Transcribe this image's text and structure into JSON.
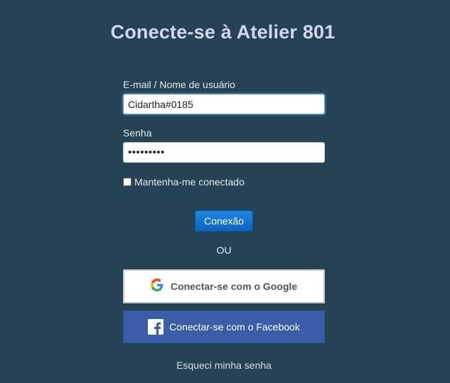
{
  "page": {
    "title": "Conecte-se à Atelier 801"
  },
  "form": {
    "email_label": "E-mail / Nome de usuário",
    "email_value": "Cidartha#0185",
    "password_label": "Senha",
    "password_value": "•••••••••",
    "remember_label": "Mantenha-me conectado",
    "remember_checked": false,
    "login_button": "Conexão"
  },
  "divider": {
    "or_text": "OU"
  },
  "social": {
    "google_label": "Conectar-se com o Google",
    "google_icon": "google-icon",
    "facebook_label": "Conectar-se com o Facebook",
    "facebook_icon": "facebook-icon"
  },
  "footer": {
    "forgot_password": "Esqueci minha senha"
  },
  "colors": {
    "background": "#264356",
    "title": "#d3d6ec",
    "login_button": "#1677d6",
    "facebook_button": "#3b5ca8"
  }
}
